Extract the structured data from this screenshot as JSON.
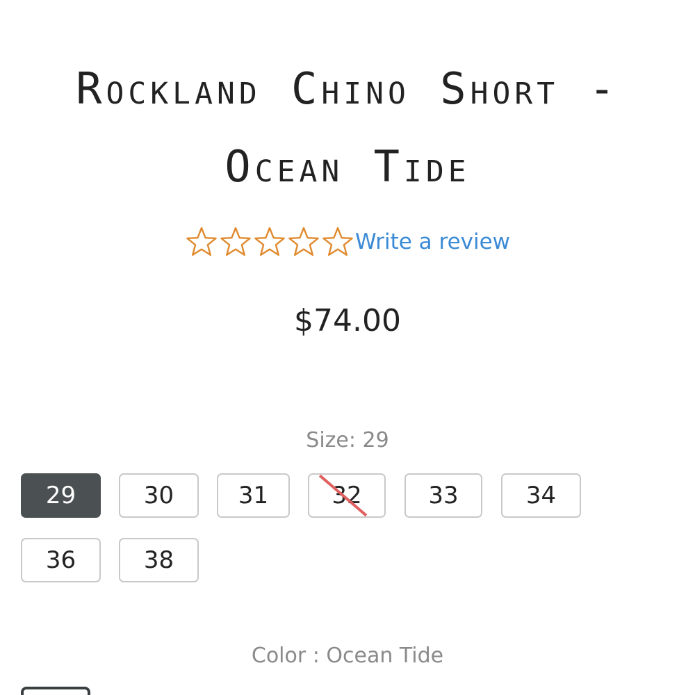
{
  "product": {
    "title": "Rockland Chino Short - Ocean Tide",
    "price": "$74.00"
  },
  "rating": {
    "stars_filled": 0,
    "stars_total": 5,
    "star_color": "#e08a2e",
    "review_link": "Write a review",
    "link_color": "#3b8ad6"
  },
  "size": {
    "label": "Size: 29",
    "options": [
      {
        "label": "29",
        "selected": true,
        "unavailable": false
      },
      {
        "label": "30",
        "selected": false,
        "unavailable": false
      },
      {
        "label": "31",
        "selected": false,
        "unavailable": false
      },
      {
        "label": "32",
        "selected": false,
        "unavailable": true
      },
      {
        "label": "33",
        "selected": false,
        "unavailable": false
      },
      {
        "label": "34",
        "selected": false,
        "unavailable": false
      },
      {
        "label": "36",
        "selected": false,
        "unavailable": false
      },
      {
        "label": "38",
        "selected": false,
        "unavailable": false
      }
    ],
    "selected_color": "#4b5052",
    "strike_color": "#e06060"
  },
  "color": {
    "label": "Color : Ocean Tide",
    "selected": "Ocean Tide"
  }
}
